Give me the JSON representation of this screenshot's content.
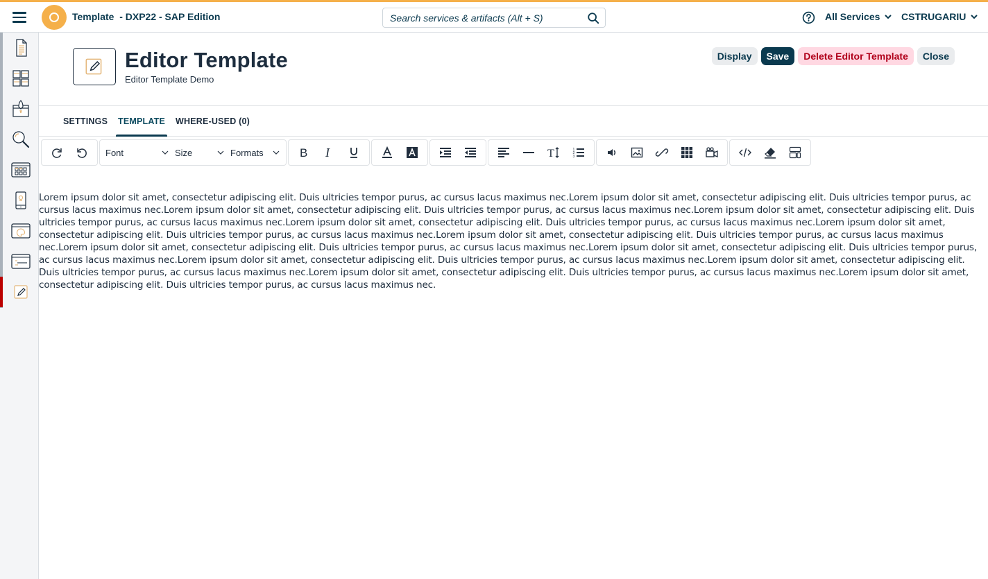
{
  "shell": {
    "app_title": "Template  - DXP22 - SAP Edition",
    "search_placeholder": "Search services & artifacts (Alt + S)",
    "services_label": "All Services",
    "user_label": "CSTRUGARIU",
    "accent_color": "#f5b04a"
  },
  "sidebar": {
    "items": [
      {
        "name": "document",
        "active": false
      },
      {
        "name": "grid-layout",
        "active": false
      },
      {
        "name": "launch",
        "active": false
      },
      {
        "name": "search",
        "active": false
      },
      {
        "name": "catalog",
        "active": false
      },
      {
        "name": "mobile",
        "active": false
      },
      {
        "name": "theme",
        "active": false
      },
      {
        "name": "form",
        "active": false
      },
      {
        "name": "editor-template",
        "active": true
      }
    ]
  },
  "header": {
    "title": "Editor Template",
    "subtitle": "Editor Template Demo",
    "actions": {
      "display": "Display",
      "save": "Save",
      "delete": "Delete Editor Template",
      "close": "Close"
    }
  },
  "tabs": [
    {
      "label": "SETTINGS",
      "active": false
    },
    {
      "label": "TEMPLATE",
      "active": true
    },
    {
      "label": "WHERE-USED (0)",
      "active": false
    }
  ],
  "toolbar": {
    "font_label": "Font",
    "size_label": "Size",
    "formats_label": "Formats",
    "buttons": [
      "undo",
      "redo",
      "bold",
      "italic",
      "underline",
      "text-color",
      "background-color",
      "indent",
      "outdent",
      "align",
      "horizontal-rule",
      "line-height",
      "numbered-list",
      "audio",
      "image",
      "link",
      "table",
      "video",
      "source-code",
      "clear-formatting",
      "template"
    ]
  },
  "editor": {
    "content": "Lorem ipsum dolor sit amet, consectetur adipiscing elit. Duis ultricies tempor purus, ac cursus lacus maximus nec.Lorem ipsum dolor sit amet, consectetur adipiscing elit. Duis ultricies tempor purus, ac cursus lacus maximus nec.Lorem ipsum dolor sit amet, consectetur adipiscing elit. Duis ultricies tempor purus, ac cursus lacus maximus nec.Lorem ipsum dolor sit amet, consectetur adipiscing elit. Duis ultricies tempor purus, ac cursus lacus maximus nec.Lorem ipsum dolor sit amet, consectetur adipiscing elit. Duis ultricies tempor purus, ac cursus lacus maximus nec.Lorem ipsum dolor sit amet, consectetur adipiscing elit. Duis ultricies tempor purus, ac cursus lacus maximus nec.Lorem ipsum dolor sit amet, consectetur adipiscing elit. Duis ultricies tempor purus, ac cursus lacus maximus nec.Lorem ipsum dolor sit amet, consectetur adipiscing elit. Duis ultricies tempor purus, ac cursus lacus maximus nec.Lorem ipsum dolor sit amet, consectetur adipiscing elit. Duis ultricies tempor purus, ac cursus lacus maximus nec.Lorem ipsum dolor sit amet, consectetur adipiscing elit. Duis ultricies tempor purus, ac cursus lacus maximus nec.Lorem ipsum dolor sit amet, consectetur adipiscing elit. Duis ultricies tempor purus, ac cursus lacus maximus nec.Lorem ipsum dolor sit amet, consectetur adipiscing elit. Duis ultricies tempor purus, ac cursus lacus maximus nec.Lorem ipsum dolor sit amet, consectetur adipiscing elit. Duis ultricies tempor purus, ac cursus lacus maximus nec."
  }
}
